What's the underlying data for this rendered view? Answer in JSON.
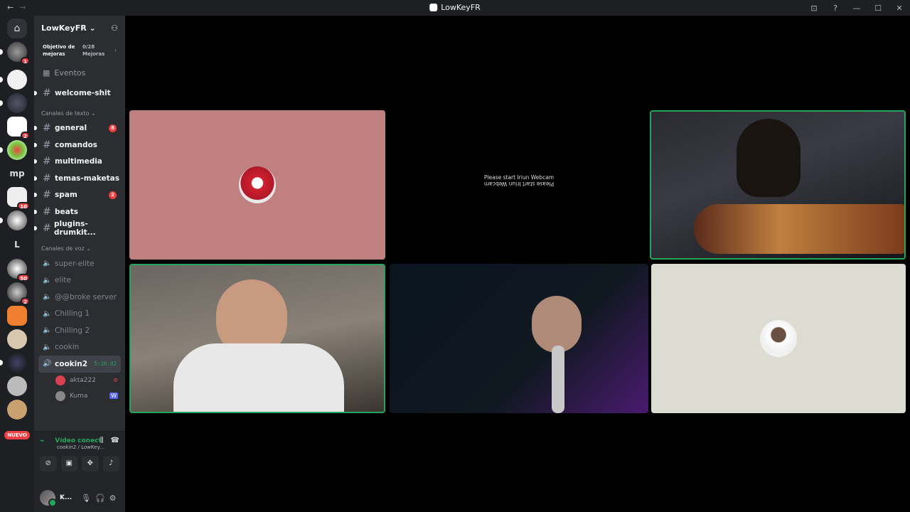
{
  "window": {
    "title": "LowKeyFR",
    "nav_back": "←",
    "nav_forward": "→",
    "controls": [
      "⊡",
      "?",
      "—",
      "☐",
      "✕"
    ]
  },
  "guilds": {
    "discord_home": "⌂",
    "badges": [
      "1",
      "2",
      "10",
      "50",
      "2"
    ],
    "text_icons": [
      "mp",
      "L"
    ],
    "nuevo": "NUEVO"
  },
  "server": {
    "name": "LowKeyFR ⌄",
    "boost_label": "Objetivo de mejoras",
    "boost_count": "0/28 Mejoras",
    "boost_arrow": "›",
    "events": "Eventos",
    "pinned_channel": "welcome-shit",
    "text_category": "Canales de texto ⌄",
    "text_channels": [
      {
        "name": "general",
        "badge": "8"
      },
      {
        "name": "comandos",
        "badge": ""
      },
      {
        "name": "multimedia",
        "badge": ""
      },
      {
        "name": "temas-maketas",
        "badge": ""
      },
      {
        "name": "spam",
        "badge": "2"
      },
      {
        "name": "beats",
        "badge": ""
      },
      {
        "name": "plugins-drumkit...",
        "badge": ""
      }
    ],
    "voice_category": "Canales de voz ⌄",
    "voice_channels": [
      "super-elite",
      "elite",
      "@@broke server",
      "Chilling 1",
      "Chilling 2",
      "cookin"
    ],
    "active_voice": {
      "name": "cookin2",
      "timer": "5:16:02"
    },
    "voice_users": [
      "akta222",
      "Kuma"
    ]
  },
  "voice_panel": {
    "status": "Vídeo conectac",
    "sub": "cookin2 / LowKey..."
  },
  "user_panel": {
    "name": "K..."
  },
  "stage": {
    "webcam_message": "Please start Iriun Webcam",
    "webcam_message_mirror": "Please start Iriun Webcam"
  },
  "colors": {
    "accent_green": "#23a55a",
    "badge_red": "#f23f43",
    "tile_pink": "#c08080",
    "tile_beige": "#dcdcd2"
  }
}
